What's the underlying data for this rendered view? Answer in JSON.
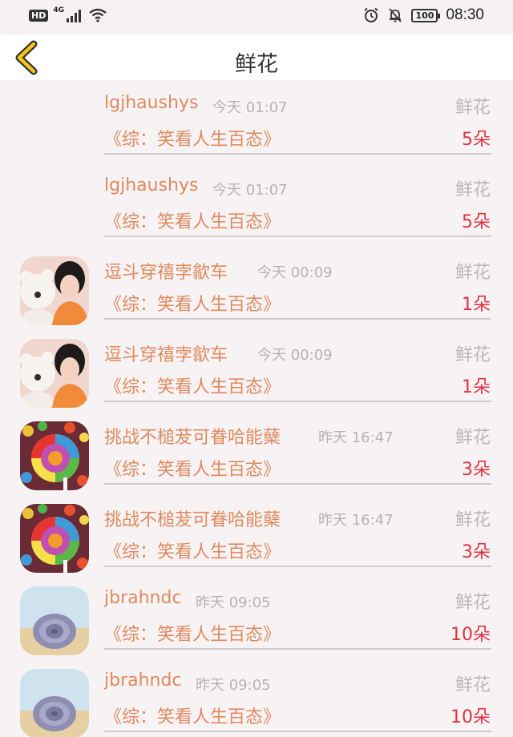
{
  "status_bar": {
    "hd": "HD",
    "network": "4G",
    "battery": "100",
    "time": "08:30"
  },
  "header": {
    "title": "鲜花",
    "accent_color": "#f5c518"
  },
  "items": [
    {
      "name": "lgjhaushys",
      "time": "今天 01:07",
      "gift": "鲜花",
      "book": "《综：笑看人生百态》",
      "count": "5朵",
      "avatar": "none"
    },
    {
      "name": "lgjhaushys",
      "time": "今天 01:07",
      "gift": "鲜花",
      "book": "《综：笑看人生百态》",
      "count": "5朵",
      "avatar": "none"
    },
    {
      "name": "逗斗穿禧孛歙车",
      "time": "今天 00:09",
      "gift": "鲜花",
      "book": "《综：笑看人生百态》",
      "count": "1朵",
      "avatar": "girl-with-bear"
    },
    {
      "name": "逗斗穿禧孛歙车",
      "time": "今天 00:09",
      "gift": "鲜花",
      "book": "《综：笑看人生百态》",
      "count": "1朵",
      "avatar": "girl-with-bear"
    },
    {
      "name": "挑战不槌茇可眷哈能蘖",
      "time": "昨天 16:47",
      "gift": "鲜花",
      "book": "《综：笑看人生百态》",
      "count": "3朵",
      "avatar": "lollipop"
    },
    {
      "name": "挑战不槌茇可眷哈能蘖",
      "time": "昨天 16:47",
      "gift": "鲜花",
      "book": "《综：笑看人生百态》",
      "count": "3朵",
      "avatar": "lollipop"
    },
    {
      "name": "jbrahndc",
      "time": "昨天 09:05",
      "gift": "鲜花",
      "book": "《综：笑看人生百态》",
      "count": "10朵",
      "avatar": "shell"
    },
    {
      "name": "jbrahndc",
      "time": "昨天 09:05",
      "gift": "鲜花",
      "book": "《综：笑看人生百态》",
      "count": "10朵",
      "avatar": "shell"
    }
  ]
}
